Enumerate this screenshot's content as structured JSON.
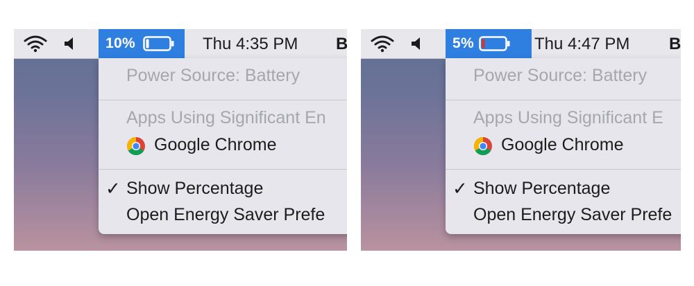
{
  "screens": [
    {
      "battery_percent": "10%",
      "battery_level": 0.1,
      "battery_fill_color": "#ffffff",
      "clock": "Thu 4:35 PM",
      "user_initial": "B",
      "menu": {
        "power_source": "Power Source: Battery",
        "apps_header": "Apps Using Significant En",
        "app_name": "Google Chrome",
        "show_percentage": "Show Percentage",
        "checkmark": "✓",
        "energy_saver": "Open Energy Saver Prefe"
      }
    },
    {
      "battery_percent": "5%",
      "battery_level": 0.05,
      "battery_fill_color": "#e0302a",
      "clock": "Thu 4:47 PM",
      "user_initial": "B",
      "menu": {
        "power_source": "Power Source: Battery",
        "apps_header": "Apps Using Significant E",
        "app_name": "Google Chrome",
        "show_percentage": "Show Percentage",
        "checkmark": "✓",
        "energy_saver": "Open Energy Saver Prefe"
      }
    }
  ],
  "icons": {
    "wifi": "wifi-icon",
    "volume": "volume-icon",
    "battery": "battery-icon",
    "app": "chrome-icon",
    "check": "checkmark-icon"
  },
  "colors": {
    "menubar_bg": "#e8e8ec",
    "highlight": "#2f7fe0",
    "menu_bg": "#e6e6ec",
    "disabled_text": "#a6a6ad"
  }
}
